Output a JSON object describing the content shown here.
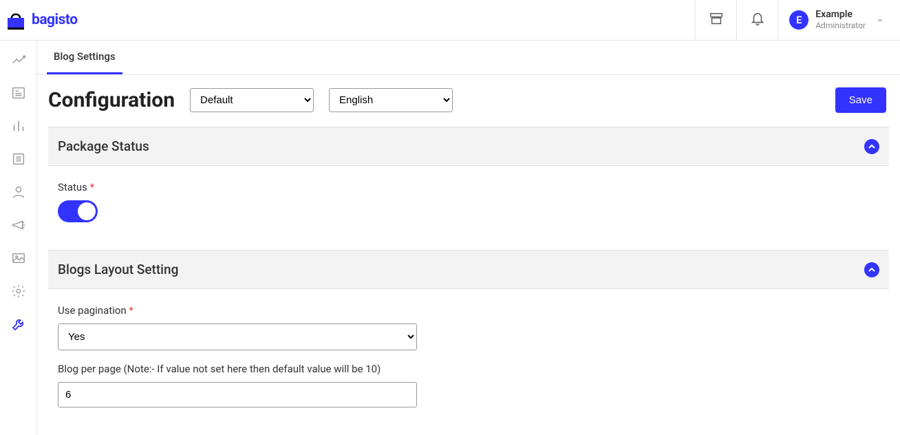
{
  "brand": {
    "name": "bagisto"
  },
  "header": {
    "user": {
      "initial": "E",
      "name": "Example",
      "role": "Administrator"
    }
  },
  "sidebar": {
    "items": [
      {
        "icon": "analytics-icon"
      },
      {
        "icon": "news-icon"
      },
      {
        "icon": "bars-icon"
      },
      {
        "icon": "list-icon"
      },
      {
        "icon": "user-icon"
      },
      {
        "icon": "megaphone-icon"
      },
      {
        "icon": "image-icon"
      },
      {
        "icon": "gear-icon"
      },
      {
        "icon": "wrench-icon",
        "active": true
      }
    ]
  },
  "tabs": {
    "active_label": "Blog Settings"
  },
  "page": {
    "title": "Configuration",
    "channel": "Default",
    "locale": "English",
    "save_label": "Save"
  },
  "sections": {
    "package_status": {
      "title": "Package Status",
      "fields": {
        "status": {
          "label": "Status",
          "required": true,
          "value": true
        }
      }
    },
    "blogs_layout": {
      "title": "Blogs Layout Setting",
      "fields": {
        "use_pagination": {
          "label": "Use pagination",
          "required": true,
          "value": "Yes"
        },
        "blog_per_page": {
          "label": "Blog per page (Note:- If value not set here then default value will be 10)",
          "value": "6"
        }
      }
    }
  }
}
